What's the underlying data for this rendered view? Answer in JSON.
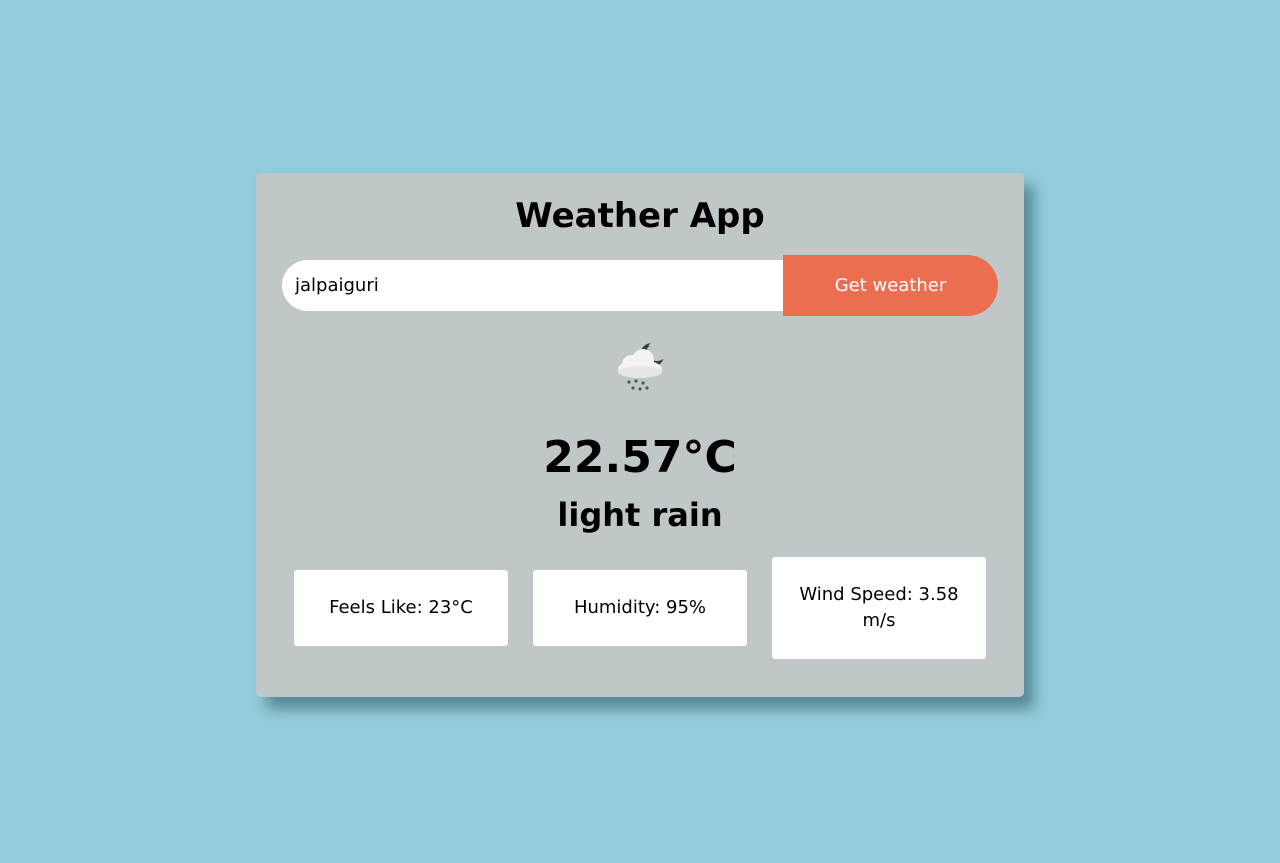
{
  "app": {
    "title": "Weather App"
  },
  "search": {
    "value": "jalpaiguri",
    "button_label": "Get weather"
  },
  "weather": {
    "icon": "light-rain-night-icon",
    "temperature": "22.57°C",
    "description": "light rain"
  },
  "details": {
    "feels_like": "Feels Like: 23°C",
    "humidity": "Humidity: 95%",
    "wind_speed": "Wind Speed: 3.58 m/s"
  },
  "colors": {
    "page_background": "#93cdd9",
    "card_background": "#c0c7c9",
    "button_background": "#ec6e50",
    "button_text": "#ffffff"
  }
}
